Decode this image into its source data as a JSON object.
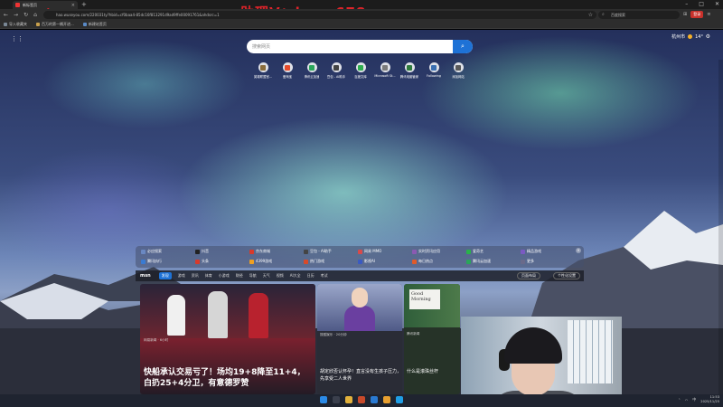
{
  "tab": {
    "title": "新标签页"
  },
  "watermark": {
    "left": "百度",
    "center": "助理V：byya678"
  },
  "address": {
    "url": "hao.wuseyou.com/220031ty?hbid=cf0baa4-85dc16f813291d9ad9ffe00091761&ahdsrc=1",
    "baidu_search": "百度搜索"
  },
  "account": {
    "label": "登录"
  },
  "bookmarks": [
    {
      "label": "导入收藏夹",
      "color": "#7a8896"
    },
    {
      "label": "百万的第一桶开进...",
      "color": "#c9a04c"
    },
    {
      "label": "新建站签页",
      "color": "#5a8ac6"
    }
  ],
  "weather": {
    "city": "杭州市",
    "temp": "14°"
  },
  "search": {
    "placeholder": "搜索网页"
  },
  "shortcuts": [
    {
      "label": "英雄联盟官...",
      "color": "#8a6c3a"
    },
    {
      "label": "爱淘宝",
      "color": "#e64b2b"
    },
    {
      "label": "腾讯云加速",
      "color": "#2aa55a"
    },
    {
      "label": "豆包 - AI助手",
      "color": "#444444"
    },
    {
      "label": "百度文库",
      "color": "#2eae4e"
    },
    {
      "label": "Microsoft St...",
      "color": "#7b7b7b"
    },
    {
      "label": "腾讯电脑管家",
      "color": "#2f7b3d"
    },
    {
      "label": "Following",
      "color": "#3a6fb2"
    },
    {
      "label": "添加网站",
      "color": "#5a5a5a"
    }
  ],
  "quick_links": {
    "row1": [
      {
        "label": "必应搜索",
        "color": "#6a88c2"
      },
      {
        "label": "抖音",
        "color": "#222222"
      },
      {
        "label": "京东商城",
        "color": "#d83a2b"
      },
      {
        "label": "豆包 - AI助手",
        "color": "#444444"
      },
      {
        "label": "网易 MMO",
        "color": "#d84a4a"
      },
      {
        "label": "实时资讯应用",
        "color": "#8a5ab2"
      },
      {
        "label": "爱奇艺",
        "color": "#29b34a"
      },
      {
        "label": "精品游戏",
        "color": "#7a5ac2"
      }
    ],
    "row2": [
      {
        "label": "腾讯执行",
        "color": "#3a7bd2"
      },
      {
        "label": "头条",
        "color": "#d83a2b"
      },
      {
        "label": "4399游戏",
        "color": "#f0a020"
      },
      {
        "label": "热门游戏",
        "color": "#d84a2a"
      },
      {
        "label": "影视AI",
        "color": "#3a5ac2"
      },
      {
        "label": "每日热点",
        "color": "#e05a2a"
      },
      {
        "label": "腾讯云加速",
        "color": "#2aa55a"
      },
      {
        "label": "更多",
        "color": "#6a6a8a"
      }
    ]
  },
  "feed": {
    "brand": "msn",
    "tabs": [
      "发现",
      "游戏",
      "资讯",
      "体育",
      "小游戏",
      "财经",
      "导航",
      "天气",
      "视频",
      "AI大全",
      "日历",
      "考试"
    ],
    "active_tab": "发现",
    "layout_btn": "页面布局",
    "personalize_btn": "个性化设置"
  },
  "cards": [
    {
      "source": "网易新闻 · 6小时",
      "title": "快船承认交易亏了！场均19+8降至11+4，白扔25+4分卫，有意德罗赞"
    },
    {
      "source": "搜狐娱乐 · 20分钟",
      "title": "胡定欣否认怀孕！直言没有生孩子压力，先享受二人世界"
    },
    {
      "source": "腾讯新闻",
      "banner": "Good Morning",
      "title": "什么是滚珠丝杆"
    }
  ],
  "taskbar": {
    "lang": "中",
    "time": "11:53",
    "date": "2025/11/25"
  }
}
